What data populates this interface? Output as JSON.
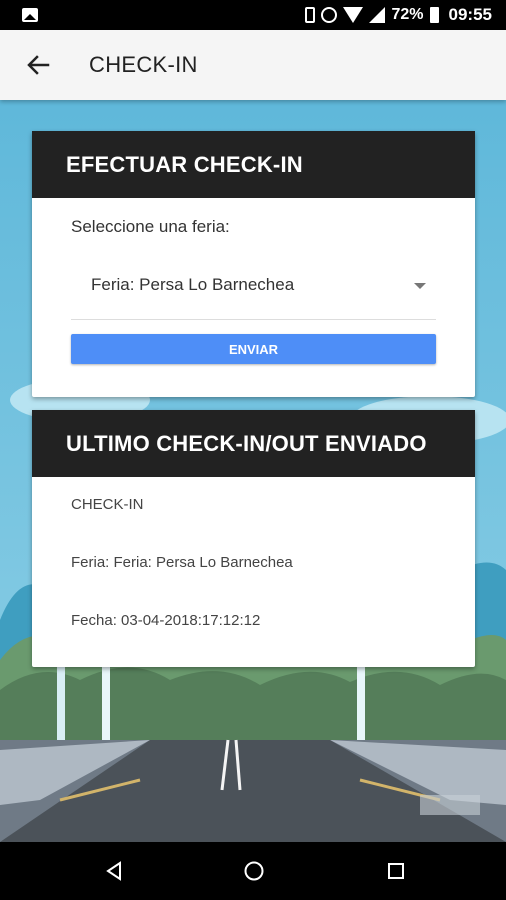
{
  "status_bar": {
    "battery_percent": "72%",
    "time": "09:55",
    "icons": [
      "image-icon",
      "vibrate-icon",
      "alarm-icon",
      "wifi-icon",
      "signal-icon",
      "battery-icon"
    ]
  },
  "app_bar": {
    "title": "CHECK-IN",
    "back_icon": "arrow-back-icon"
  },
  "checkin_card": {
    "header": "EFECTUAR CHECK-IN",
    "select_label": "Seleccione una feria:",
    "selected_fair": "Feria: Persa Lo Barnechea",
    "send_label": "ENVIAR"
  },
  "last_card": {
    "header": "ULTIMO CHECK-IN/OUT ENVIADO",
    "type": "CHECK-IN",
    "fair": "Feria: Feria: Persa Lo Barnechea",
    "date": "Fecha: 03-04-2018:17:12:12"
  },
  "nav_bar": {
    "icons": [
      "nav-back-icon",
      "nav-home-icon",
      "nav-recents-icon"
    ]
  },
  "colors": {
    "accent": "#4e8ef7",
    "card_header": "#222222",
    "app_bar": "#f5f5f5"
  }
}
